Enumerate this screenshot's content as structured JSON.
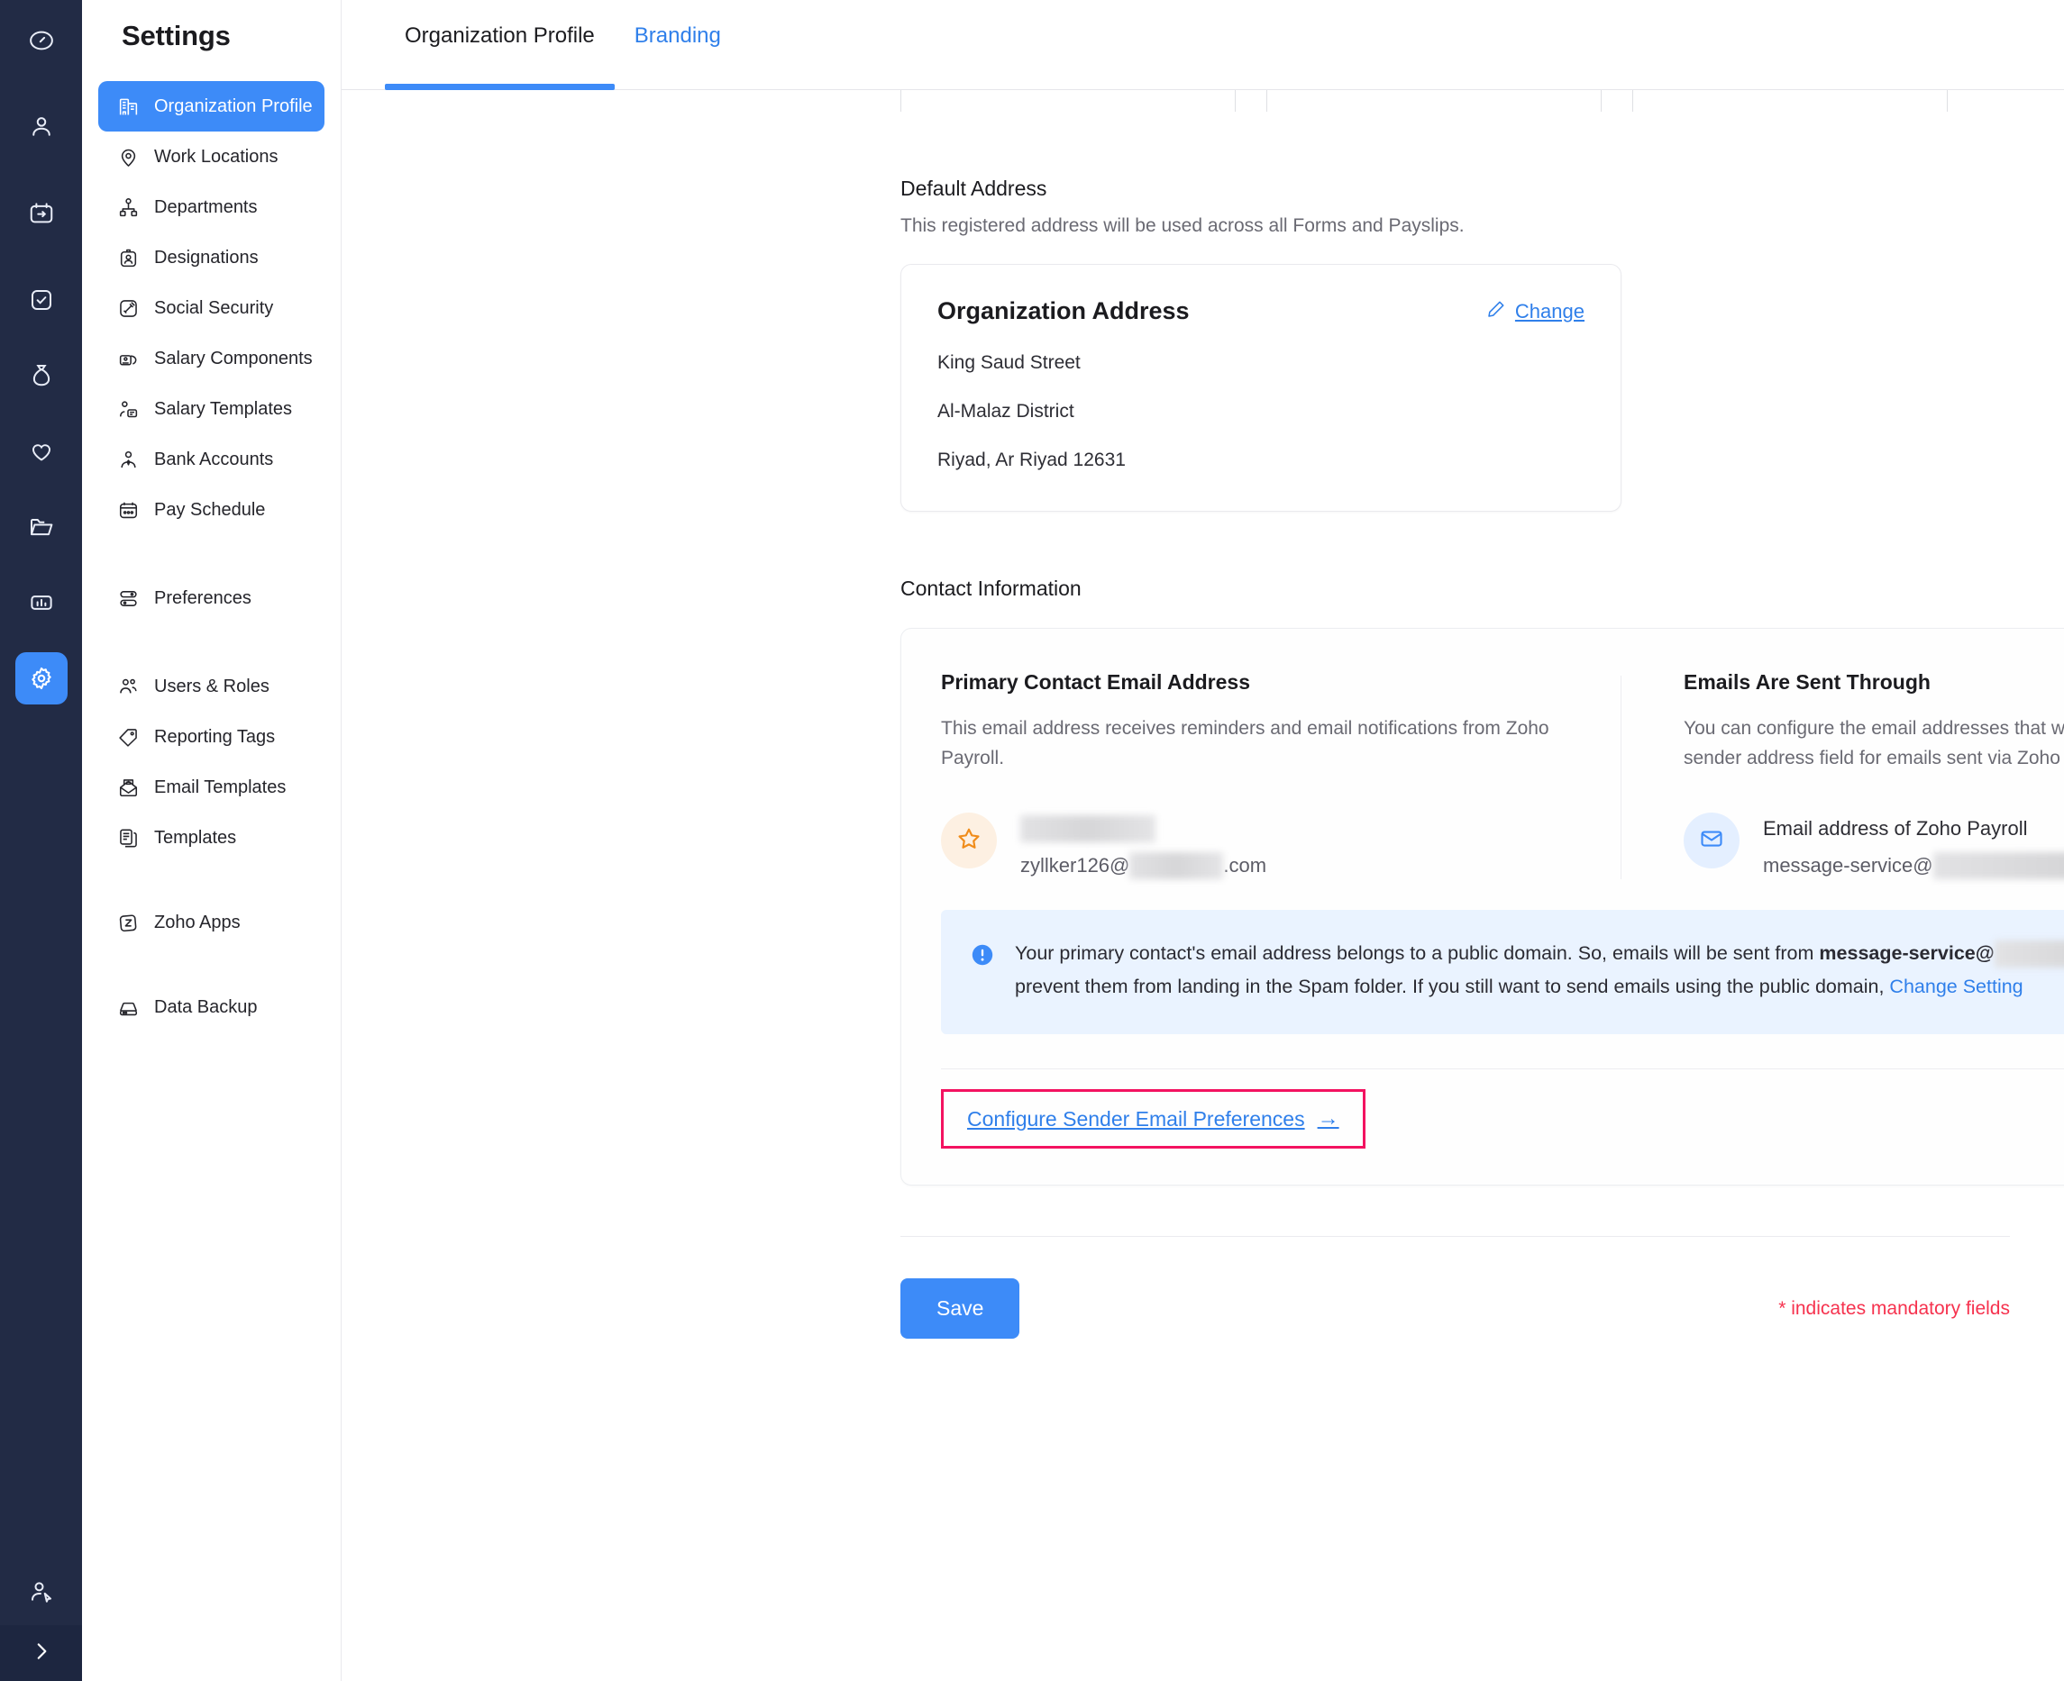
{
  "rail": {
    "items": [
      {
        "icon": "speedometer-icon",
        "name": "dashboard",
        "active": false
      },
      {
        "icon": "user-icon",
        "name": "employees",
        "active": false
      },
      {
        "icon": "calendar-arrow-icon",
        "name": "leave",
        "active": false
      },
      {
        "icon": "checkbox-icon",
        "name": "approvals",
        "active": false
      },
      {
        "icon": "money-bag-icon",
        "name": "payroll",
        "active": false
      },
      {
        "icon": "heart-icon",
        "name": "benefits",
        "active": false
      },
      {
        "icon": "folder-icon",
        "name": "documents",
        "active": false
      },
      {
        "icon": "bar-chart-icon",
        "name": "reports",
        "active": false
      },
      {
        "icon": "gear-icon",
        "name": "settings",
        "active": true
      }
    ],
    "bottom": [
      {
        "icon": "user-cursor-icon",
        "name": "account"
      },
      {
        "icon": "chevron-right-icon",
        "name": "expand-sidebar"
      }
    ]
  },
  "sidebar": {
    "title": "Settings",
    "groups": [
      {
        "items": [
          {
            "label": "Organization Profile",
            "icon": "building-icon",
            "active": true
          },
          {
            "label": "Work Locations",
            "icon": "map-pin-icon",
            "active": false
          },
          {
            "label": "Departments",
            "icon": "org-chart-icon",
            "active": false
          },
          {
            "label": "Designations",
            "icon": "id-badge-icon",
            "active": false
          },
          {
            "label": "Social Security",
            "icon": "gavel-icon",
            "active": false
          },
          {
            "label": "Salary Components",
            "icon": "cards-icon",
            "active": false
          },
          {
            "label": "Salary Templates",
            "icon": "person-card-icon",
            "active": false
          },
          {
            "label": "Bank Accounts",
            "icon": "person-tie-icon",
            "active": false
          },
          {
            "label": "Pay Schedule",
            "icon": "calendar-dots-icon",
            "active": false
          }
        ]
      },
      {
        "items": [
          {
            "label": "Preferences",
            "icon": "sliders-icon",
            "active": false
          }
        ]
      },
      {
        "items": [
          {
            "label": "Users & Roles",
            "icon": "users-icon",
            "active": false
          },
          {
            "label": "Reporting Tags",
            "icon": "tag-icon",
            "active": false
          },
          {
            "label": "Email Templates",
            "icon": "open-envelope-icon",
            "active": false
          },
          {
            "label": "Templates",
            "icon": "documents-icon",
            "active": false
          }
        ]
      },
      {
        "items": [
          {
            "label": "Zoho Apps",
            "icon": "zoho-z-icon",
            "active": false
          }
        ]
      },
      {
        "items": [
          {
            "label": "Data Backup",
            "icon": "hard-drive-icon",
            "active": false
          }
        ]
      }
    ]
  },
  "tabs": [
    {
      "label": "Organization Profile",
      "active": true
    },
    {
      "label": "Branding",
      "active": false
    }
  ],
  "default_address": {
    "heading": "Default Address",
    "subtext": "This registered address will be used across all Forms and Payslips.",
    "card_title": "Organization Address",
    "change_label": "Change",
    "lines": [
      "King Saud Street",
      "Al-Malaz District",
      "Riyad, Ar Riyad 12631"
    ]
  },
  "contact_information": {
    "heading": "Contact Information",
    "primary": {
      "title": "Primary Contact Email Address",
      "desc": "This email address receives reminders and email notifications from Zoho Payroll.",
      "name_redacted": "",
      "email_prefix": "zyllker126@",
      "email_suffix": ".com"
    },
    "sender": {
      "title": "Emails Are Sent Through",
      "desc": "You can configure the email addresses that would be used in the sender address field for emails sent via Zoho Payroll.",
      "label": "Email address of Zoho Payroll",
      "email_prefix": "message-service@"
    },
    "notice": {
      "part1": "Your primary contact's email address belongs to a public domain. So, emails will be sent from ",
      "bold": "message-service@",
      "part2": " to prevent them from landing in the Spam folder. If you still want to send emails using the public domain, ",
      "link": "Change Setting"
    },
    "configure_link": "Configure Sender Email Preferences",
    "configure_arrow": "→"
  },
  "footer": {
    "save_label": "Save",
    "mandatory_note": "* indicates mandatory fields"
  },
  "colors": {
    "accent": "#3d8bf8",
    "link": "#2f7fea",
    "rail_bg": "#222b45",
    "highlight_box": "#f31260",
    "mandatory": "#f6324e",
    "notice_bg": "#eaf3ff",
    "star_bg": "#fdf0e2",
    "star_stroke": "#f08c1a"
  }
}
